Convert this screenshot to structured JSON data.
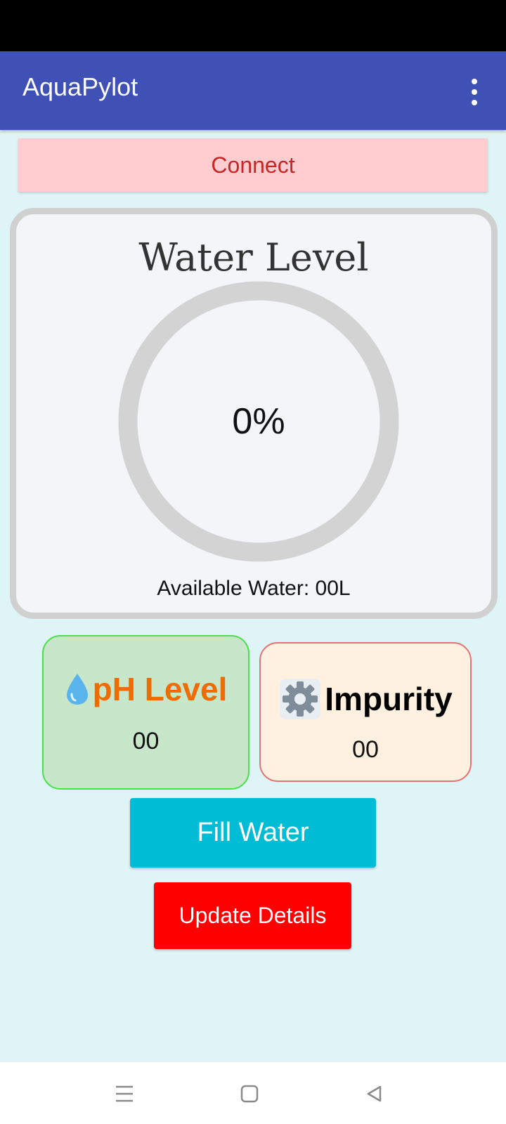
{
  "colors": {
    "app_bar": "#3f51b5",
    "connect_bg": "#ffccd0",
    "connect_text": "#c62828",
    "fill_button": "#00bcd4",
    "update_button": "#ff0000",
    "ph_card_bg": "#c8e6c9",
    "ph_label": "#ef6c00",
    "impurity_card_bg": "#fff0df"
  },
  "app_bar": {
    "title": "AquaPylot",
    "menu_icon": "overflow-menu-icon"
  },
  "connect": {
    "label": "Connect"
  },
  "water_level": {
    "title": "Water Level",
    "percent_text": "0%",
    "fill_fraction": 0,
    "available_text": "Available Water: 00L"
  },
  "ph": {
    "icon": "water-drop-icon",
    "label": "pH Level",
    "value": "00"
  },
  "impurity": {
    "icon": "gear-icon",
    "label": "Impurity",
    "value": "00"
  },
  "actions": {
    "fill_label": "Fill Water",
    "update_label": "Update Details"
  },
  "nav": {
    "menu_icon": "recent-apps-icon",
    "home_icon": "home-icon",
    "back_icon": "back-icon"
  }
}
